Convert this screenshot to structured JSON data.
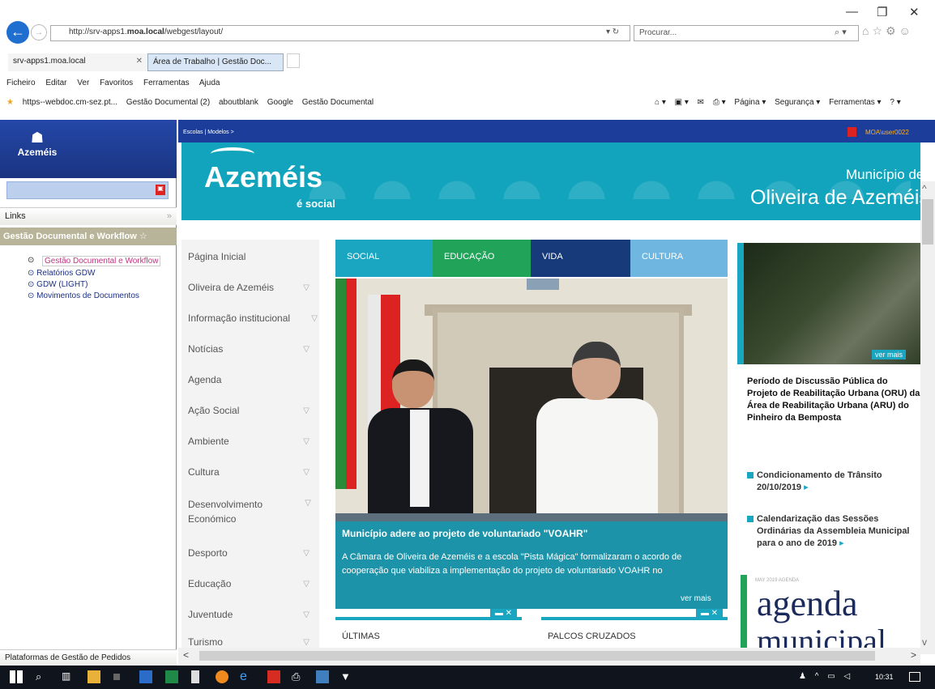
{
  "browser": {
    "url_prefix": "http://srv-apps1.",
    "url_domain": "moa.local",
    "url_path": "/webgest/layout/",
    "search_placeholder": "Procurar...",
    "addr_controls": "▾ ↻",
    "tabs": [
      {
        "label": "srv-apps1.moa.local"
      },
      {
        "label": "Área de Trabalho | Gestão Doc..."
      }
    ],
    "menu": [
      "Ficheiro",
      "Editar",
      "Ver",
      "Favoritos",
      "Ferramentas",
      "Ajuda"
    ],
    "favorites": [
      "https--webdoc.cm-sez.pt...",
      "Gestão Documental (2)",
      "aboutblank",
      "Google",
      "Gestão Documental"
    ],
    "commands": [
      "Página ▾",
      "Segurança ▾",
      "Ferramentas ▾"
    ]
  },
  "left_panel": {
    "logo_text": "Azeméis",
    "links_label": "Links",
    "section_label": "Gestão Documental e Workflow ☆",
    "items": [
      {
        "label": "Gestão Documental e Workflow"
      },
      {
        "label": "Relatórios GDW"
      },
      {
        "label": "GDW (LIGHT)"
      },
      {
        "label": "Movimentos de Documentos"
      }
    ],
    "bottom_label": "Plataformas de Gestão de Pedidos"
  },
  "content": {
    "breadcrumb": "Escolas | Modelos >",
    "user_label": "MOA\\user0022",
    "logo": {
      "main": "Azeméis",
      "sub": "é social"
    },
    "municipality_line1": "Município de",
    "municipality_line2": "Oliveira de Azeméis",
    "side_menu": [
      {
        "label": "Página Inicial",
        "arrow": false
      },
      {
        "label": "Oliveira de Azeméis",
        "arrow": true
      },
      {
        "label": "Informação institucional",
        "arrow": true
      },
      {
        "label": "Notícias",
        "arrow": true
      },
      {
        "label": "Agenda",
        "arrow": false
      },
      {
        "label": "Ação Social",
        "arrow": true
      },
      {
        "label": "Ambiente",
        "arrow": true
      },
      {
        "label": "Cultura",
        "arrow": true
      },
      {
        "label": "Desenvolvimento Económico",
        "arrow": true
      },
      {
        "label": "Desporto",
        "arrow": true
      },
      {
        "label": "Educação",
        "arrow": true
      },
      {
        "label": "Juventude",
        "arrow": true
      },
      {
        "label": "Turismo",
        "arrow": true
      }
    ],
    "carousel_tabs": [
      "SOCIAL",
      "EDUCAÇÃO",
      "VIDA",
      "CULTURA"
    ],
    "carousel": {
      "title": "Município adere ao projeto de voluntariado \"VOAHR\"",
      "text": "A Câmara de Oliveira de Azeméis e a escola \"Pista Mágica\" formalizaram o acordo de cooperação que viabiliza a implementação do projeto de voluntariado VOAHR no",
      "more": "ver mais"
    },
    "boxes": [
      {
        "title": "ÚLTIMAS",
        "ctl": "▬   ✕"
      },
      {
        "title": "PALCOS CRUZADOS",
        "ctl": "▬   ✕"
      }
    ],
    "right": {
      "thumb_more": "ver mais",
      "headline": "Período de Discussão Pública do Projeto de Reabilitação Urbana (ORU) da Área de Reabilitação Urbana (ARU) do Pinheiro da Bemposta",
      "links": [
        {
          "label": "Condicionamento de Trânsito 20/10/2019"
        },
        {
          "label": "Calendarização das Sessões Ordinárias da Assembleia Municipal para o ano de 2019"
        }
      ],
      "agenda_small": "MAY 2019 AGENDA",
      "agenda_big": "agenda",
      "agenda_2": "municipal"
    }
  },
  "taskbar": {
    "clock": "10:31"
  },
  "colors": {
    "brand_teal": "#12a4bd",
    "nav_blue": "#1c3e9a",
    "tab_green": "#21a35a",
    "tab_navy": "#173a7a",
    "tab_light": "#6fb6e0"
  }
}
